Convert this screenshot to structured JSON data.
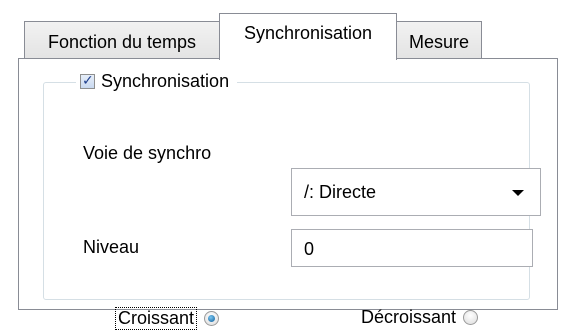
{
  "tabs": [
    {
      "label": "Fonction du temps",
      "active": false
    },
    {
      "label": "Synchronisation",
      "active": true
    },
    {
      "label": "Mesure",
      "active": false
    }
  ],
  "group": {
    "checkbox_label": "Synchronisation",
    "checked": true
  },
  "fields": {
    "voie_label": "Voie de synchro",
    "voie_value": "/: Directe",
    "niveau_label": "Niveau",
    "niveau_value": "0"
  },
  "radios": {
    "croissant_label": "Croissant",
    "croissant_checked": true,
    "decroissant_label": "Décroissant",
    "decroissant_checked": false
  },
  "colors": {
    "border": "#898c95",
    "group_border": "#d5dfe5",
    "radio_selected": "#0d5c97"
  }
}
